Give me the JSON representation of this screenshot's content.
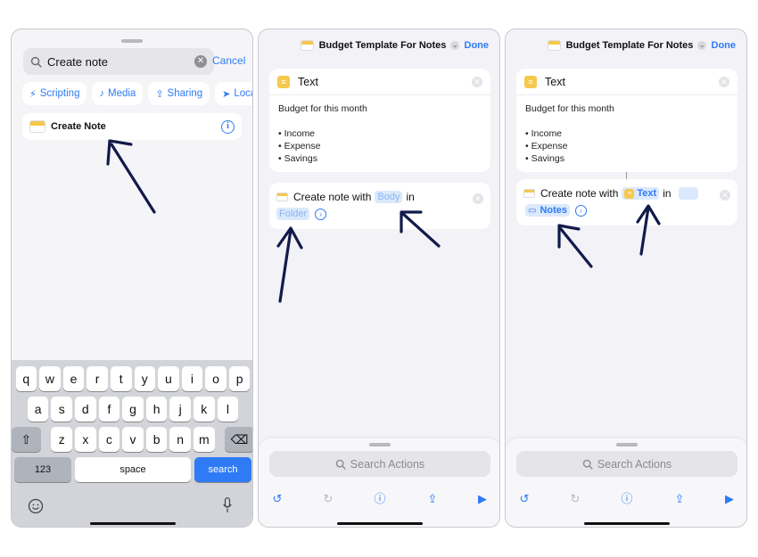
{
  "panel1": {
    "search": {
      "value": "Create note",
      "clear_icon": "clear-circle-icon"
    },
    "cancel_label": "Cancel",
    "chips": [
      {
        "label": "Scripting",
        "icon": "scripting-icon"
      },
      {
        "label": "Media",
        "icon": "music-note-icon"
      },
      {
        "label": "Sharing",
        "icon": "share-icon"
      },
      {
        "label": "Loca",
        "icon": "location-icon"
      }
    ],
    "result": {
      "label": "Create Note",
      "info": "i"
    },
    "keyboard": {
      "row1": [
        "q",
        "w",
        "e",
        "r",
        "t",
        "y",
        "u",
        "i",
        "o",
        "p"
      ],
      "row2": [
        "a",
        "s",
        "d",
        "f",
        "g",
        "h",
        "j",
        "k",
        "l"
      ],
      "row3": [
        "z",
        "x",
        "c",
        "v",
        "b",
        "n",
        "m"
      ],
      "numbers_label": "123",
      "space_label": "space",
      "search_label": "search"
    }
  },
  "panel2": {
    "nav_title": "Budget Template For Notes",
    "done_label": "Done",
    "text_card": {
      "title": "Text",
      "lines": [
        "Budget for this month",
        "",
        "• Income",
        "• Expense",
        "• Savings"
      ]
    },
    "action": {
      "prefix": "Create note with",
      "body_token": "Body",
      "in_label": "in",
      "folder_token": "Folder"
    },
    "search_actions": "Search Actions"
  },
  "panel3": {
    "nav_title": "Budget Template For Notes",
    "done_label": "Done",
    "text_card": {
      "title": "Text",
      "lines": [
        "Budget for this month",
        "",
        "• Income",
        "• Expense",
        "• Savings"
      ]
    },
    "action": {
      "prefix": "Create note with",
      "text_token": "Text",
      "in_label": "in",
      "folder_token": "Notes"
    },
    "search_actions": "Search Actions"
  },
  "colors": {
    "accent": "#2f7bf5",
    "notes_yellow": "#f6c84c",
    "arrow": "#121a4a"
  }
}
